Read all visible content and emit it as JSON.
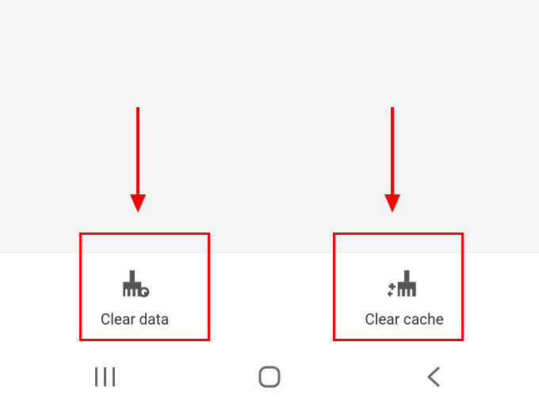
{
  "actions": {
    "clear_data": {
      "label": "Clear data"
    },
    "clear_cache": {
      "label": "Clear cache"
    }
  },
  "annotation": {
    "highlight_color": "#ff0000"
  }
}
